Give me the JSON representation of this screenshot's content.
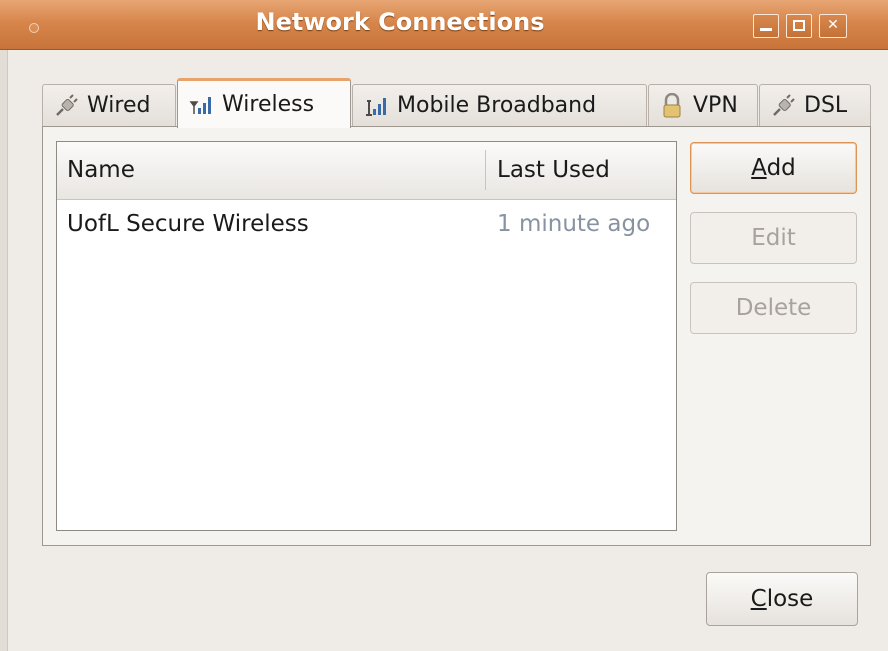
{
  "window": {
    "title": "Network Connections"
  },
  "tabs": [
    {
      "label": "Wired",
      "icon": "plug-icon",
      "active": false
    },
    {
      "label": "Wireless",
      "icon": "wireless-signal-icon",
      "active": true
    },
    {
      "label": "Mobile Broadband",
      "icon": "mobile-signal-icon",
      "active": false
    },
    {
      "label": "VPN",
      "icon": "lock-icon",
      "active": false
    },
    {
      "label": "DSL",
      "icon": "plug-icon",
      "active": false
    }
  ],
  "list": {
    "columns": [
      "Name",
      "Last Used"
    ],
    "rows": [
      {
        "name": "UofL Secure Wireless",
        "last_used": "1 minute ago"
      }
    ]
  },
  "buttons": {
    "add": {
      "mnemonic": "A",
      "rest": "dd"
    },
    "edit": "Edit",
    "delete": "Delete",
    "close": {
      "mnemonic": "C",
      "rest": "lose"
    }
  },
  "colors": {
    "titlebar": "#d7864b",
    "accent": "#e8a36b",
    "muted_text": "#8793a2",
    "disabled_text": "#a7a29c"
  }
}
